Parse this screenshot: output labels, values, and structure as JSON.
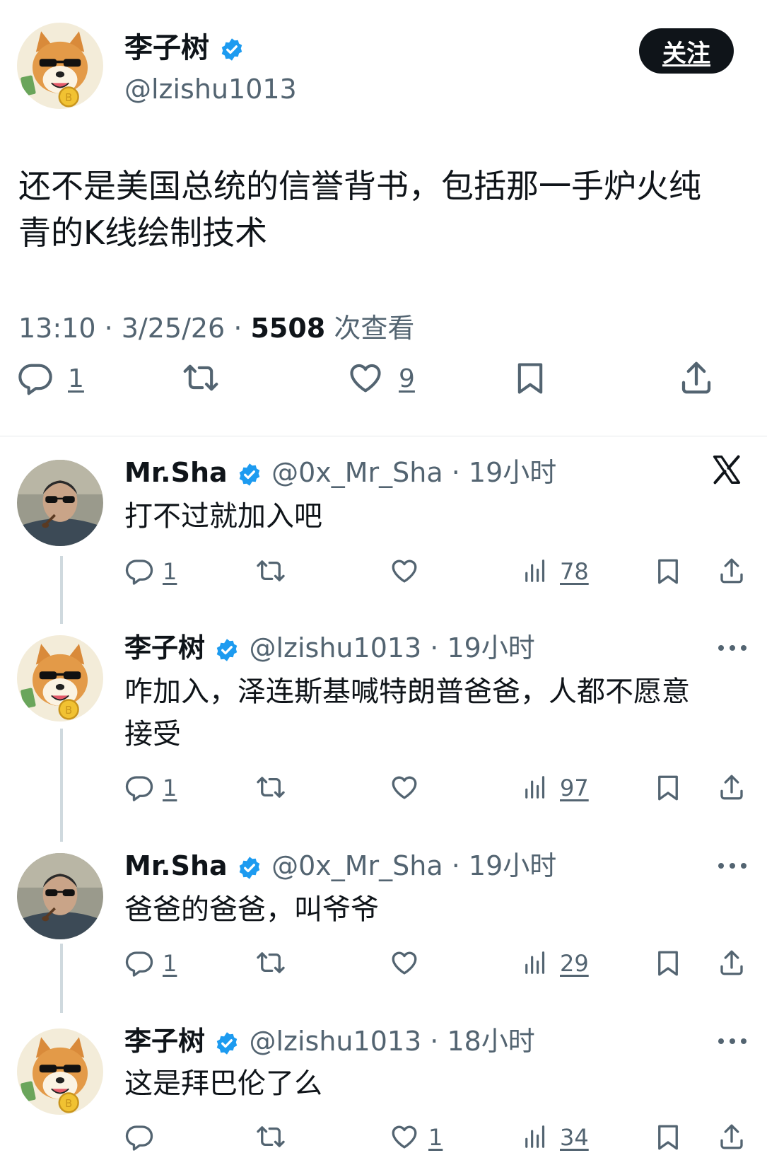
{
  "main": {
    "name": "李子树",
    "handle": "@lzishu1013",
    "follow_label": "关注",
    "text_line1": "还不是美国总统的信誉背书，包括那一手炉火纯",
    "text_line2": "青的K线绘制技术",
    "time": "13:10 · 3/25/26 · ",
    "views": "5508",
    "views_label": " 次查看",
    "replies": "1",
    "likes": "9"
  },
  "replies": [
    {
      "name": "Mr.Sha",
      "handle": "@0x_Mr_Sha · 19小时",
      "text": "打不过就加入吧",
      "text2": "",
      "replies": "1",
      "likes": "",
      "views": "78"
    },
    {
      "name": "李子树",
      "handle": "@lzishu1013 · 19小时",
      "text": "咋加入，泽连斯基喊特朗普爸爸，人都不愿意",
      "text2": "接受",
      "replies": "1",
      "likes": "",
      "views": "97"
    },
    {
      "name": "Mr.Sha",
      "handle": "@0x_Mr_Sha · 19小时",
      "text": "爸爸的爸爸，叫爷爷",
      "text2": "",
      "replies": "1",
      "likes": "",
      "views": "29"
    },
    {
      "name": "李子树",
      "handle": "@lzishu1013 · 18小时",
      "text": "这是拜巴伦了么",
      "text2": "",
      "replies": "",
      "likes": "1",
      "views": "34"
    }
  ],
  "colors": {
    "verified": "#1d9bf0",
    "muted": "#536471",
    "text": "#0f1419"
  },
  "icons": [
    "reply-icon",
    "retweet-icon",
    "like-icon",
    "views-icon",
    "bookmark-icon",
    "share-icon",
    "x-logo-icon",
    "more-icon",
    "verified-badge-icon"
  ]
}
